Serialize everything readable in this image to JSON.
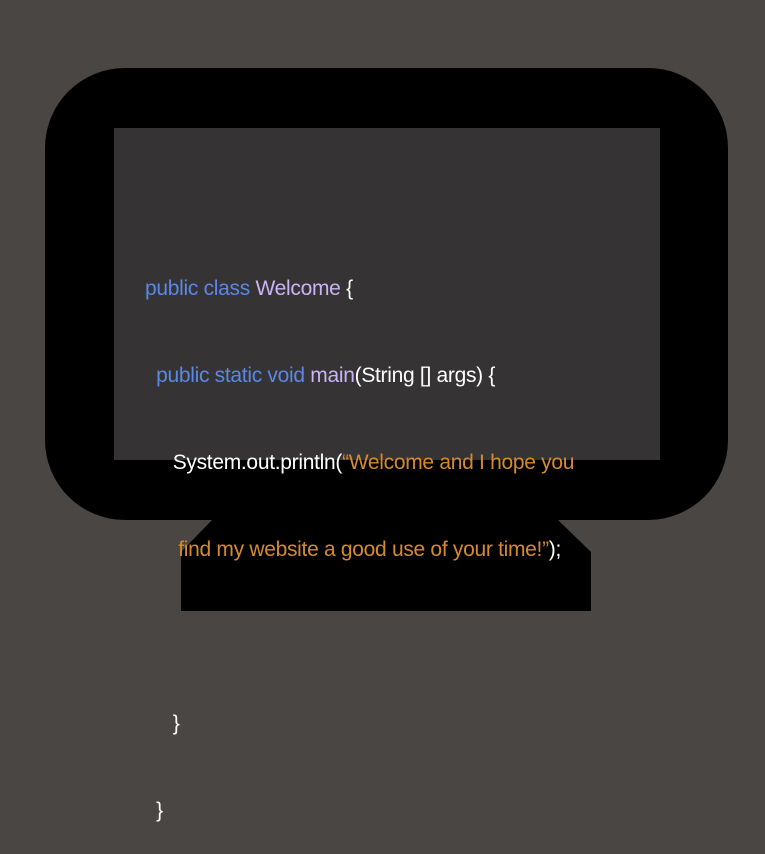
{
  "colors": {
    "background": "#4a4644",
    "bezel": "#000000",
    "screen": "#353333",
    "keyword": "#5b87e8",
    "identifier": "#c9b4f4",
    "string": "#d58a2e",
    "plain": "#ffffff"
  },
  "code": {
    "line1": {
      "kw": "public class ",
      "name": "Welcome",
      "brace": " {"
    },
    "line2": {
      "indent": "  ",
      "kw": "public static void ",
      "method": "main",
      "rest": "(String [] args) {"
    },
    "line3": {
      "indent": "     ",
      "call": "System.out.println(",
      "str": "“Welcome and I hope you"
    },
    "line4": {
      "indent": "      ",
      "str": "find my website a good use of your time!”",
      "end": ");"
    },
    "line6": {
      "indent": "     ",
      "brace": "}"
    },
    "line7": {
      "indent": "  ",
      "brace": "}"
    }
  }
}
